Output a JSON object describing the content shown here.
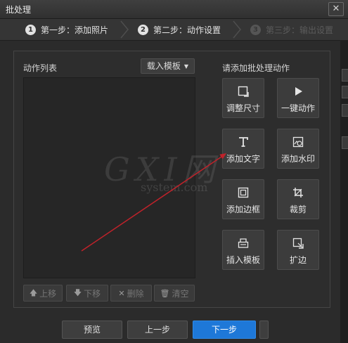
{
  "window": {
    "title": "批处理",
    "close_glyph": "✕"
  },
  "steps": [
    {
      "number": "1",
      "label": "第一步：添加照片"
    },
    {
      "number": "2",
      "label": "第二步：动作设置"
    },
    {
      "number": "3",
      "label": "第三步：输出设置"
    }
  ],
  "action_list": {
    "label": "动作列表",
    "template_button": "载入模板",
    "template_arrow": "▼"
  },
  "list_controls": [
    {
      "label": "上移",
      "icon": "up-arrow-icon",
      "glyph": "🡅"
    },
    {
      "label": "下移",
      "icon": "down-arrow-icon",
      "glyph": "🡇"
    },
    {
      "label": "删除",
      "icon": "delete-x-icon",
      "glyph": "✕"
    },
    {
      "label": "清空",
      "icon": "trash-icon",
      "glyph": "🗑"
    }
  ],
  "add_panel": {
    "label": "请添加批处理动作",
    "actions": [
      {
        "label": "调整尺寸",
        "icon": "resize-icon"
      },
      {
        "label": "一键动作",
        "icon": "play-icon"
      },
      {
        "label": "添加文字",
        "icon": "text-icon"
      },
      {
        "label": "添加水印",
        "icon": "watermark-icon"
      },
      {
        "label": "添加边框",
        "icon": "border-icon"
      },
      {
        "label": "裁剪",
        "icon": "crop-icon"
      },
      {
        "label": "插入模板",
        "icon": "template-icon"
      },
      {
        "label": "扩边",
        "icon": "expand-icon"
      }
    ]
  },
  "footer": {
    "preview": "预览",
    "prev": "上一步",
    "next": "下一步"
  },
  "watermark": {
    "main": "GXI网",
    "sub": "system.com"
  },
  "annotation": {
    "color": "#c0222a"
  },
  "colors": {
    "accent_blue": "#1e78d8"
  }
}
